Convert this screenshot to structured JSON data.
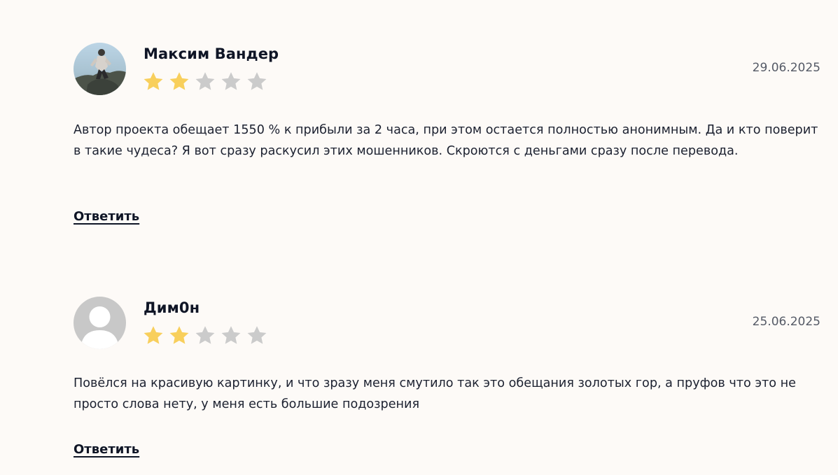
{
  "reviews": [
    {
      "author": "Максим Вандер",
      "rating": 2,
      "max_rating": 5,
      "date": "29.06.2025",
      "text": "Автор проекта обещает 1550 % к прибыли за 2 часа, при этом остается полностью анонимным. Да и кто поверит в такие чудеса? Я вот сразу раскусил этих мошенников. Скроются с деньгами сразу после перевода.",
      "reply_label": "Ответить",
      "avatar": "photo-avatar"
    },
    {
      "author": "Дим0н",
      "rating": 2,
      "max_rating": 5,
      "date": "25.06.2025",
      "text": "Повёлся на красивую картинку, и что зразу меня смутило так это обещания золотых гор, а пруфов что это не просто слова нету, у меня есть большие подозрения",
      "reply_label": "Ответить",
      "avatar": "default-user-avatar"
    }
  ],
  "colors": {
    "star_filled": "#f8cf5c",
    "star_empty": "#cbcbcb",
    "background": "#fdfaf7"
  }
}
